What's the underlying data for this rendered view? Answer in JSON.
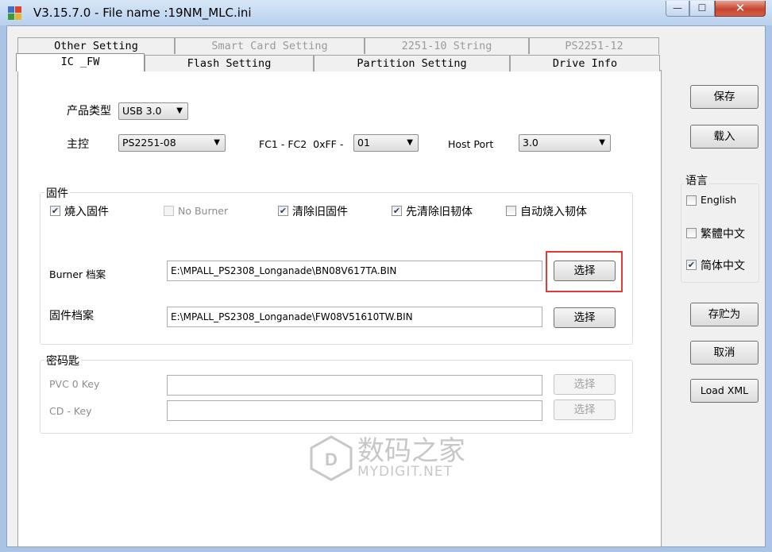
{
  "window": {
    "title": "V3.15.7.0 - File name :19NM_MLC.ini",
    "controls": {
      "minimize": "—",
      "maximize": "☐",
      "close": "✕"
    }
  },
  "tabs": {
    "row1": [
      {
        "label": "Other Setting",
        "enabled": true
      },
      {
        "label": "Smart Card Setting",
        "enabled": false
      },
      {
        "label": "2251-10 String",
        "enabled": false
      },
      {
        "label": "PS2251-12",
        "enabled": false
      }
    ],
    "row2": [
      {
        "label": "IC _FW",
        "active": true
      },
      {
        "label": "Flash Setting"
      },
      {
        "label": "Partition Setting"
      },
      {
        "label": "Drive Info"
      }
    ]
  },
  "ic_fw": {
    "product_type": {
      "label": "产品类型",
      "value": "USB 3.0"
    },
    "controller": {
      "label": "主控",
      "value": "PS2251-08"
    },
    "fc": {
      "label": "FC1 - FC2  0xFF -",
      "value": "01"
    },
    "host_port": {
      "label": "Host Port",
      "value": "3.0"
    },
    "firmware_group": {
      "title": "固件",
      "options": [
        {
          "label": "燒入固件",
          "checked": true,
          "enabled": true
        },
        {
          "label": "No Burner",
          "checked": false,
          "enabled": false
        },
        {
          "label": "清除旧固件",
          "checked": true,
          "enabled": true
        },
        {
          "label": "先清除旧韧体",
          "checked": true,
          "enabled": true
        },
        {
          "label": "自动烧入韧体",
          "checked": false,
          "enabled": true
        }
      ],
      "burner_file": {
        "label": "Burner 档案",
        "value": "E:\\MPALL_PS2308_Longanade\\BN08V617TA.BIN",
        "button": "选择"
      },
      "firmware_file": {
        "label": "固件档案",
        "value": "E:\\MPALL_PS2308_Longanade\\FW08V51610TW.BIN",
        "button": "选择"
      }
    },
    "key_group": {
      "title": "密码匙",
      "pvc_key": {
        "label": "PVC 0 Key",
        "value": "",
        "button": "选择"
      },
      "cd_key": {
        "label": "CD - Key",
        "value": "",
        "button": "选择"
      }
    }
  },
  "sidebar": {
    "save": "保存",
    "load": "载入",
    "language": {
      "title": "语言",
      "options": [
        {
          "label": "English",
          "checked": false
        },
        {
          "label": "繁體中文",
          "checked": false
        },
        {
          "label": "简体中文",
          "checked": true
        }
      ]
    },
    "save_as": "存贮为",
    "cancel": "取消",
    "load_xml": "Load XML"
  },
  "watermark": {
    "cn": "数码之家",
    "en": "MYDIGIT.NET"
  },
  "colors": {
    "highlight": "#e03a3a",
    "titlebar": "#c4d8f0",
    "close": "#c7452f"
  }
}
